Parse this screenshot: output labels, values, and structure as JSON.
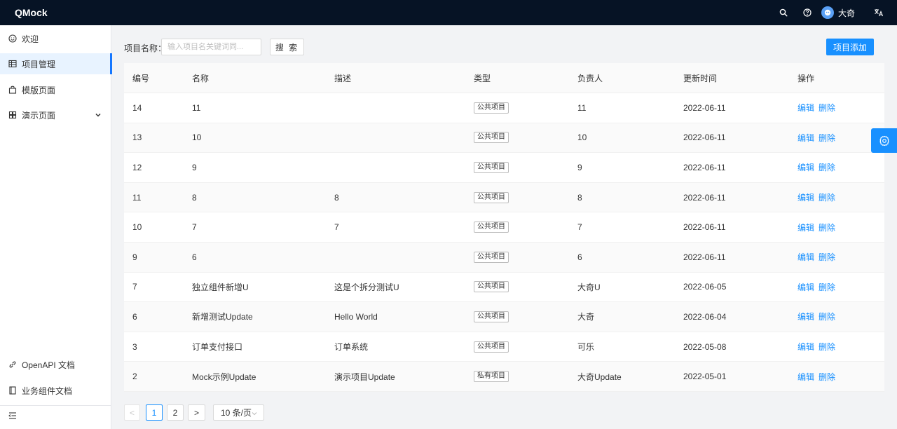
{
  "app": {
    "title": "QMock"
  },
  "header": {
    "user_name": "大奇"
  },
  "sidebar": {
    "items": [
      {
        "label": "欢迎"
      },
      {
        "label": "项目管理"
      },
      {
        "label": "模版页面"
      },
      {
        "label": "演示页面"
      }
    ],
    "bottom": [
      {
        "label": "OpenAPI 文档"
      },
      {
        "label": "业务组件文档"
      }
    ]
  },
  "search": {
    "label": "项目名称：",
    "placeholder": "输入项目名关键词同...",
    "value": "",
    "button": "搜 索"
  },
  "add_button": "项目添加",
  "table": {
    "headers": [
      "编号",
      "名称",
      "描述",
      "类型",
      "负责人",
      "更新时间",
      "操作"
    ],
    "rows": [
      {
        "id": "14",
        "name": "11",
        "desc": "",
        "type": "公共项目",
        "owner": "11",
        "updated": "2022-06-11",
        "edit": "编辑",
        "delete": "删除"
      },
      {
        "id": "13",
        "name": "10",
        "desc": "",
        "type": "公共项目",
        "owner": "10",
        "updated": "2022-06-11",
        "edit": "编辑",
        "delete": "删除"
      },
      {
        "id": "12",
        "name": "9",
        "desc": "",
        "type": "公共项目",
        "owner": "9",
        "updated": "2022-06-11",
        "edit": "编辑",
        "delete": "删除"
      },
      {
        "id": "11",
        "name": "8",
        "desc": "8",
        "type": "公共项目",
        "owner": "8",
        "updated": "2022-06-11",
        "edit": "编辑",
        "delete": "删除"
      },
      {
        "id": "10",
        "name": "7",
        "desc": "7",
        "type": "公共项目",
        "owner": "7",
        "updated": "2022-06-11",
        "edit": "编辑",
        "delete": "删除"
      },
      {
        "id": "9",
        "name": "6",
        "desc": "",
        "type": "公共项目",
        "owner": "6",
        "updated": "2022-06-11",
        "edit": "编辑",
        "delete": "删除"
      },
      {
        "id": "7",
        "name": "独立组件新增U",
        "desc": "这是个拆分测试U",
        "type": "公共项目",
        "owner": "大奇U",
        "updated": "2022-06-05",
        "edit": "编辑",
        "delete": "删除"
      },
      {
        "id": "6",
        "name": "新增测试Update",
        "desc": "Hello World",
        "type": "公共项目",
        "owner": "大奇",
        "updated": "2022-06-04",
        "edit": "编辑",
        "delete": "删除"
      },
      {
        "id": "3",
        "name": "订单支付接口",
        "desc": "订单系统",
        "type": "公共项目",
        "owner": "可乐",
        "updated": "2022-05-08",
        "edit": "编辑",
        "delete": "删除"
      },
      {
        "id": "2",
        "name": "Mock示例Update",
        "desc": "演示项目Update",
        "type": "私有项目",
        "owner": "大奇Update",
        "updated": "2022-05-01",
        "edit": "编辑",
        "delete": "删除"
      }
    ]
  },
  "pagination": {
    "prev": "<",
    "pages": [
      "1",
      "2"
    ],
    "current": "1",
    "next": ">",
    "page_size": "10 条/页"
  },
  "colors": {
    "primary": "#1890ff",
    "header_bg": "#061325",
    "menu_active_bg": "#e8f3ff"
  },
  "icons": {
    "header": [
      "search-icon",
      "help-icon",
      "avatar-icon",
      "translate-icon"
    ],
    "sidebar": [
      "smile-icon",
      "grid-icon",
      "bag-icon",
      "dashboard-icon",
      "link-icon",
      "book-icon",
      "menu-fold-icon"
    ],
    "float": "gear-icon"
  }
}
